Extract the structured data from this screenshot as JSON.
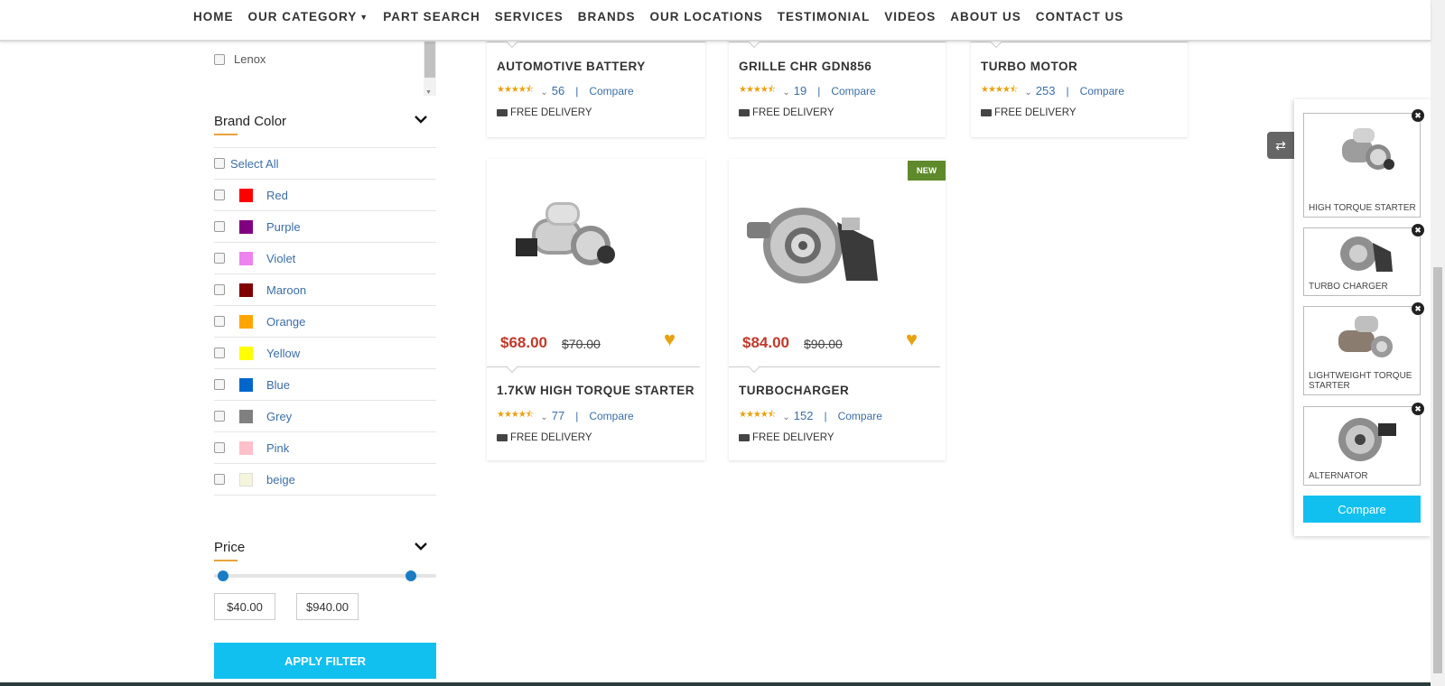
{
  "nav": {
    "items": [
      "HOME",
      "OUR CATEGORY",
      "PART SEARCH",
      "SERVICES",
      "BRANDS",
      "OUR LOCATIONS",
      "TESTIMONIAL",
      "VIDEOS",
      "ABOUT US",
      "CONTACT US"
    ]
  },
  "sidebar": {
    "brand_item": "Lenox",
    "brand_color_title": "Brand Color",
    "select_all": "Select All",
    "colors": [
      {
        "name": "Red",
        "hex": "#ff0000"
      },
      {
        "name": "Purple",
        "hex": "#800080"
      },
      {
        "name": "Violet",
        "hex": "#ee82ee"
      },
      {
        "name": "Maroon",
        "hex": "#800000"
      },
      {
        "name": "Orange",
        "hex": "#ffa500"
      },
      {
        "name": "Yellow",
        "hex": "#ffff00"
      },
      {
        "name": "Blue",
        "hex": "#0066cc"
      },
      {
        "name": "Grey",
        "hex": "#808080"
      },
      {
        "name": "Pink",
        "hex": "#ffc0cb"
      },
      {
        "name": "beige",
        "hex": "#f5f5dc"
      }
    ],
    "price_title": "Price",
    "price_min": "$40.00",
    "price_max": "$940.00",
    "apply_label": "APPLY FILTER"
  },
  "products_row1": [
    {
      "name": "AUTOMOTIVE BATTERY",
      "reviews": "56",
      "compare": "Compare",
      "delivery": "FREE DELIVERY"
    },
    {
      "name": "GRILLE CHR GDN856",
      "reviews": "19",
      "compare": "Compare",
      "delivery": "FREE DELIVERY"
    },
    {
      "name": "TURBO MOTOR",
      "reviews": "253",
      "compare": "Compare",
      "delivery": "FREE DELIVERY"
    }
  ],
  "products_row2": [
    {
      "name": "1.7KW HIGH TORQUE STARTER",
      "price": "$68.00",
      "old_price": "$70.00",
      "reviews": "77",
      "compare": "Compare",
      "delivery": "FREE DELIVERY"
    },
    {
      "name": "TURBOCHARGER",
      "price": "$84.00",
      "old_price": "$90.00",
      "reviews": "152",
      "compare": "Compare",
      "delivery": "FREE DELIVERY",
      "badge": "NEW"
    }
  ],
  "rating_stars": "★★★★⯪",
  "compare_panel": {
    "items": [
      "HIGH TORQUE STARTER",
      "TURBO CHARGER",
      "LIGHTWEIGHT TORQUE STARTER",
      "ALTERNATOR"
    ],
    "button": "Compare"
  }
}
